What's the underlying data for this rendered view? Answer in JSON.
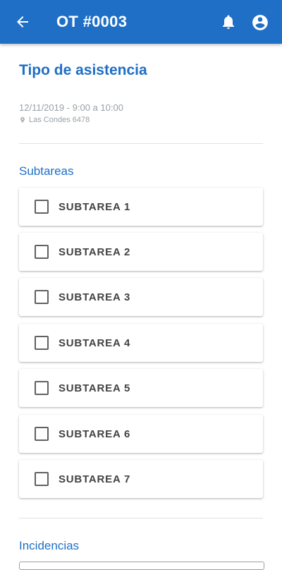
{
  "header": {
    "title": "OT #0003",
    "background_color": "#1f6fc6",
    "back_icon": "arrow-back-icon",
    "notifications_icon": "bell-icon",
    "account_icon": "account-circle-icon"
  },
  "detail": {
    "title": "Tipo de asistencia",
    "datetime": "12/11/2019 - 9:00 a 10:00",
    "location": "Las Condes 6478",
    "location_icon": "location-pin-icon"
  },
  "subtasks": {
    "header": "Subtareas",
    "items": [
      {
        "label": "SUBTAREA 1",
        "checked": false
      },
      {
        "label": "SUBTAREA 2",
        "checked": false
      },
      {
        "label": "SUBTAREA 3",
        "checked": false
      },
      {
        "label": "SUBTAREA 4",
        "checked": false
      },
      {
        "label": "SUBTAREA 5",
        "checked": false
      },
      {
        "label": "SUBTAREA 6",
        "checked": false
      },
      {
        "label": "SUBTAREA 7",
        "checked": false
      }
    ]
  },
  "incidents": {
    "header": "Incidencias"
  }
}
